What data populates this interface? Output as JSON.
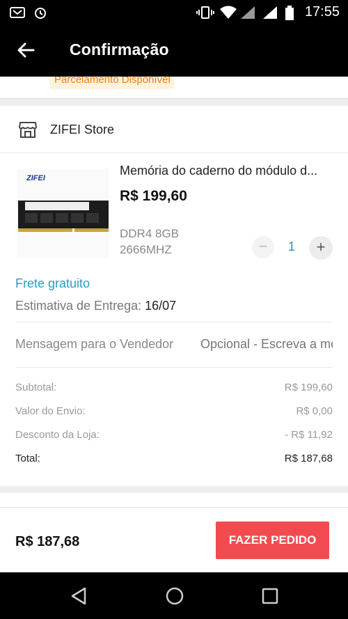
{
  "status_bar": {
    "time": "17:55"
  },
  "app_bar": {
    "title": "Confirmação"
  },
  "top_card": {
    "installments_badge": "Parcelamento Disponível"
  },
  "store": {
    "name": "ZIFEI Store"
  },
  "product": {
    "name": "Memória do caderno do módulo d...",
    "price": "R$ 199,60",
    "variant_line1": "DDR4 8GB",
    "variant_line2": "2666MHZ",
    "quantity": "1",
    "minus_label": "−",
    "plus_label": "+",
    "image_label": "ZIFEI"
  },
  "shipping": {
    "free_label": "Frete gratuito",
    "estimate_label": "Estimativa de Entrega: ",
    "estimate_date": "16/07"
  },
  "message": {
    "label": "Mensagem para o Vendedor",
    "placeholder": "Opcional - Escreva a mensagem"
  },
  "summary": {
    "subtotal_label": "Subtotal:",
    "subtotal_value": "R$ 199,60",
    "shipping_label": "Valor do Envio:",
    "shipping_value": "R$ 0,00",
    "discount_label": "Desconto da Loja:",
    "discount_value": "- R$ 11,92",
    "total_label": "Total:",
    "total_value": "R$ 187,68"
  },
  "footer": {
    "grand_total": "R$ 187,68",
    "order_button": "FAZER PEDIDO"
  },
  "colors": {
    "accent_blue": "#2e9bc6",
    "order_red": "#f24b4f",
    "badge_orange": "#f57c00"
  }
}
